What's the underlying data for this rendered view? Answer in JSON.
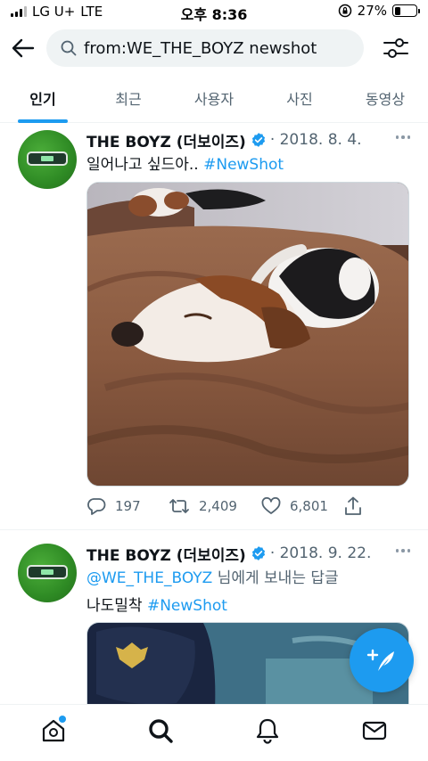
{
  "status_bar": {
    "carrier": "LG U+",
    "network": "LTE",
    "time": "오후 8:36",
    "battery_percent": "27%",
    "battery_level": 0.27
  },
  "search": {
    "query": "from:WE_THE_BOYZ newshot",
    "back_icon": "back-arrow-icon",
    "filter_icon": "filter-sliders-icon"
  },
  "tabs": [
    {
      "label": "인기",
      "active": true
    },
    {
      "label": "최근",
      "active": false
    },
    {
      "label": "사용자",
      "active": false
    },
    {
      "label": "사진",
      "active": false
    },
    {
      "label": "동영상",
      "active": false
    }
  ],
  "tweets": [
    {
      "author": "THE BOYZ (더보이즈)",
      "verified": true,
      "date": "· 2018. 8. 4.",
      "text": "일어나고 싶드아.. ",
      "hashtag": "#NewShot",
      "media_alt": "dogs sleeping on a brown blanket",
      "reply_count": "197",
      "retweet_count": "2,409",
      "like_count": "6,801"
    },
    {
      "author": "THE BOYZ (더보이즈)",
      "verified": true,
      "date": "· 2018. 9. 22.",
      "reply_to_mention": "@WE_THE_BOYZ",
      "reply_to_suffix": " 님에게 보내는 답글",
      "text": "나도밀착 ",
      "hashtag": "#NewShot"
    }
  ],
  "colors": {
    "accent": "#1d9bf0",
    "text": "#0f1419",
    "secondary": "#536471"
  },
  "bottom_nav": [
    "home-icon",
    "search-icon",
    "notifications-bell-icon",
    "messages-icon"
  ]
}
